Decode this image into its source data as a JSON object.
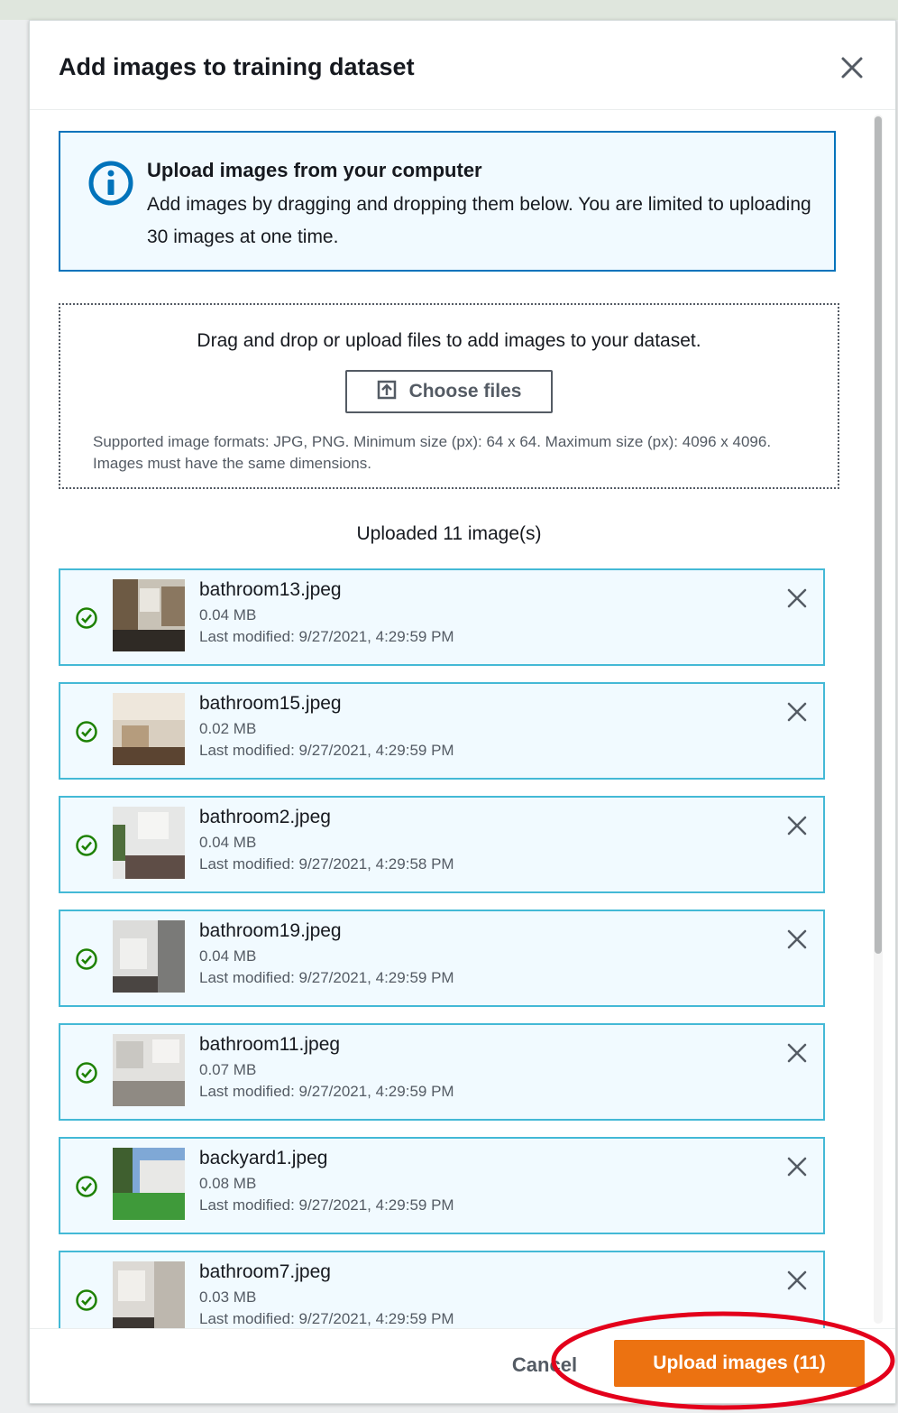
{
  "dialog": {
    "title": "Add images to training dataset",
    "close_icon": "close-icon"
  },
  "info": {
    "icon": "info-icon",
    "title": "Upload images from your computer",
    "text": "Add images by dragging and dropping them below. You are limited to uploading 30 images at one time."
  },
  "dropzone": {
    "prompt": "Drag and drop or upload files to add images to your dataset.",
    "choose_files_label": "Choose files",
    "choose_files_icon": "upload-icon",
    "hint": "Supported image formats: JPG, PNG. Minimum size (px): 64 x 64. Maximum size (px): 4096 x 4096. Images must have the same dimensions."
  },
  "uploaded_count": "Uploaded 11 image(s)",
  "files": [
    {
      "name": "bathroom13.jpeg",
      "size": "0.04 MB",
      "modified": "Last modified: 9/27/2021, 4:29:59 PM"
    },
    {
      "name": "bathroom15.jpeg",
      "size": "0.02 MB",
      "modified": "Last modified: 9/27/2021, 4:29:59 PM"
    },
    {
      "name": "bathroom2.jpeg",
      "size": "0.04 MB",
      "modified": "Last modified: 9/27/2021, 4:29:58 PM"
    },
    {
      "name": "bathroom19.jpeg",
      "size": "0.04 MB",
      "modified": "Last modified: 9/27/2021, 4:29:59 PM"
    },
    {
      "name": "bathroom11.jpeg",
      "size": "0.07 MB",
      "modified": "Last modified: 9/27/2021, 4:29:59 PM"
    },
    {
      "name": "backyard1.jpeg",
      "size": "0.08 MB",
      "modified": "Last modified: 9/27/2021, 4:29:59 PM"
    },
    {
      "name": "bathroom7.jpeg",
      "size": "0.03 MB",
      "modified": "Last modified: 9/27/2021, 4:29:59 PM"
    }
  ],
  "footer": {
    "cancel_label": "Cancel",
    "upload_label": "Upload images (11)"
  },
  "colors": {
    "primary_button": "#ec7211",
    "info_border": "#0073bb",
    "file_border": "#44b9d6",
    "success": "#1d8102",
    "annotation": "#e3001b"
  }
}
